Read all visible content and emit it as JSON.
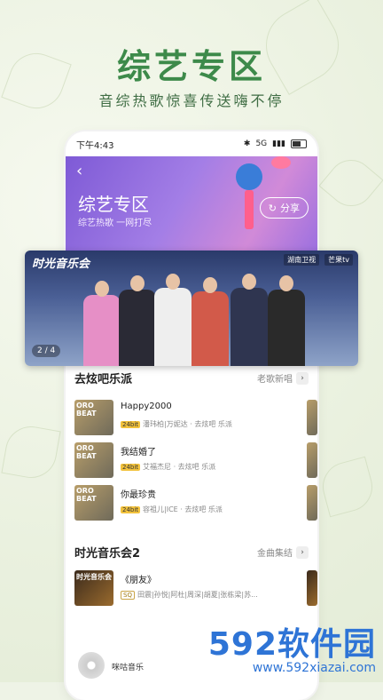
{
  "promo": {
    "title": "综艺专区",
    "subtitle": "音综热歌惊喜传送嗨不停"
  },
  "status_bar": {
    "time": "下午4:43",
    "network": "5G"
  },
  "header": {
    "title": "综艺专区",
    "subtitle": "综艺热歌 一网打尽",
    "share_label": "分享"
  },
  "banner": {
    "show_logo": "时光音乐会",
    "channel1": "湖南卫视",
    "channel2": "芒果tv",
    "pager": "2 / 4"
  },
  "section1": {
    "title": "去炫吧乐派",
    "more": "老歌新唱",
    "songs": [
      {
        "title": "Happy2000",
        "badge": "24bit",
        "artists": "潘玮柏|万妮达 · 去炫吧 乐派"
      },
      {
        "title": "我结婚了",
        "badge": "24bit",
        "artists": "艾福杰尼 · 去炫吧 乐派"
      },
      {
        "title": "你最珍贵",
        "badge": "24bit",
        "artists": "容祖儿|ICE · 去炫吧 乐派"
      }
    ]
  },
  "section2": {
    "title": "时光音乐会2",
    "more": "金曲集结",
    "songs": [
      {
        "title": "《朋友》",
        "badge": "SQ",
        "artists": "田震|孙悦|阿杜|周深|胡夏|张栋梁|苏..."
      }
    ]
  },
  "miniplayer": {
    "name": "咪咕音乐"
  },
  "watermark": {
    "brand": "592软件园",
    "url": "www.592xiazai.com"
  },
  "colors": {
    "accent": "#3d8a4a",
    "header_start": "#7e5ad6",
    "watermark": "#2e74d6"
  }
}
